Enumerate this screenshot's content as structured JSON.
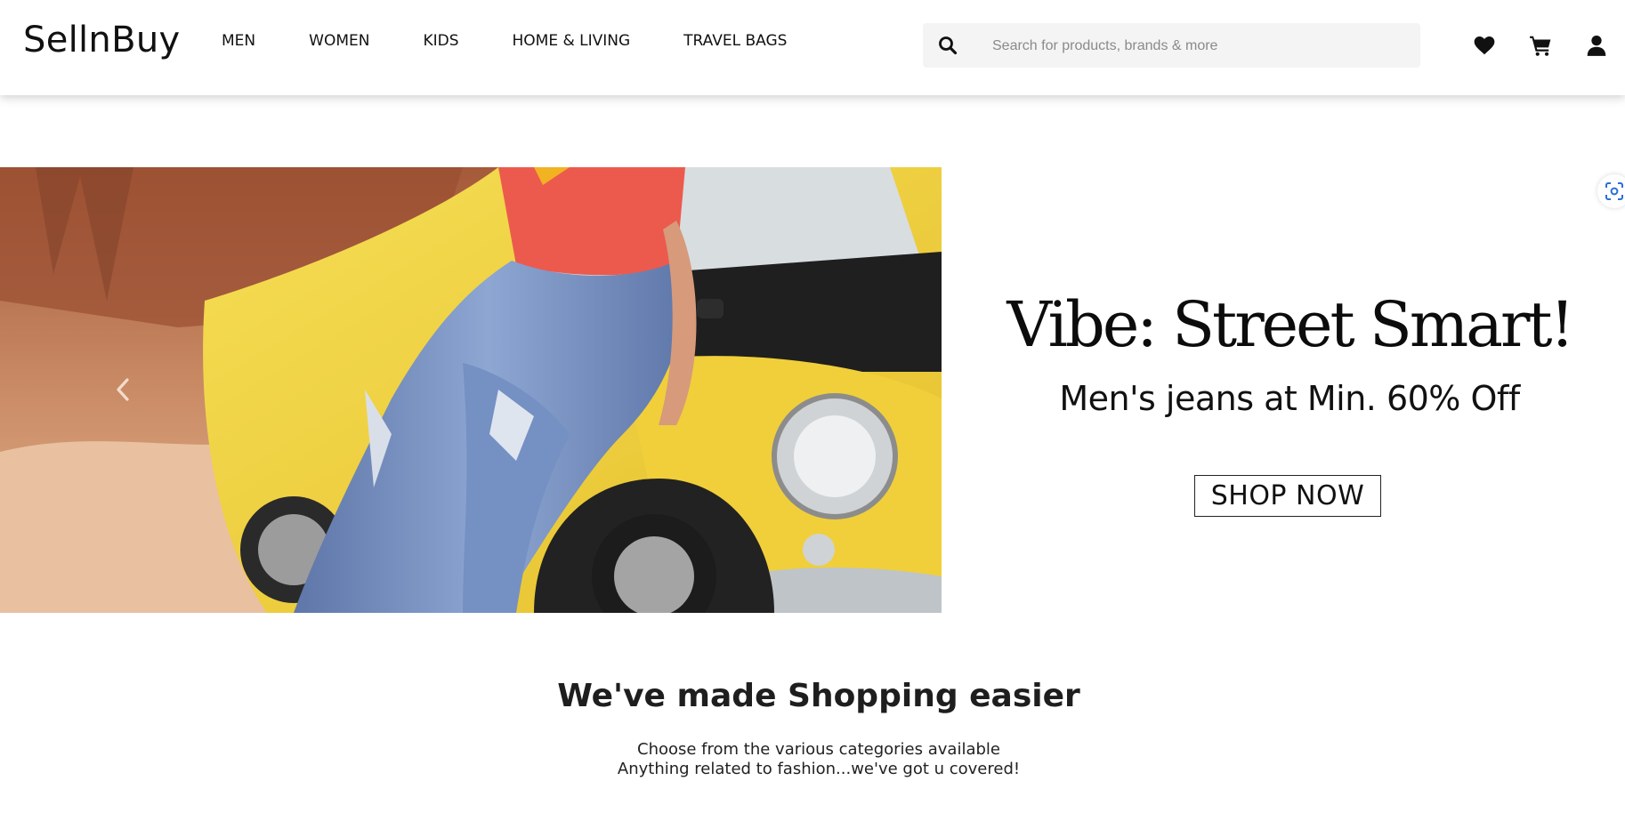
{
  "header": {
    "logo": "SellnBuy",
    "nav": [
      "MEN",
      "WOMEN",
      "KIDS",
      "HOME & LIVING",
      "TRAVEL BAGS"
    ],
    "search": {
      "placeholder": "Search for products, brands & more",
      "icon": "search-icon"
    },
    "icons": [
      "heart-icon",
      "cart-icon",
      "user-icon"
    ]
  },
  "banner": {
    "headline": "Vibe: Street Smart!",
    "offer": "Men's jeans at Min. 60% Off",
    "cta": "SHOP NOW",
    "image_description_icon": "banner-photo"
  },
  "section": {
    "title": "We've made Shopping easier",
    "subtitle_line1": "Choose from the various categories available",
    "subtitle_line2": "Anything related to fashion...we've got u covered!"
  },
  "colors": {
    "header_bg": "#ffffff",
    "search_bg": "#f4f4f4",
    "car_yellow": "#f2d33c",
    "shirt_red": "#ec5a4d",
    "jeans": "#6f86b5"
  }
}
